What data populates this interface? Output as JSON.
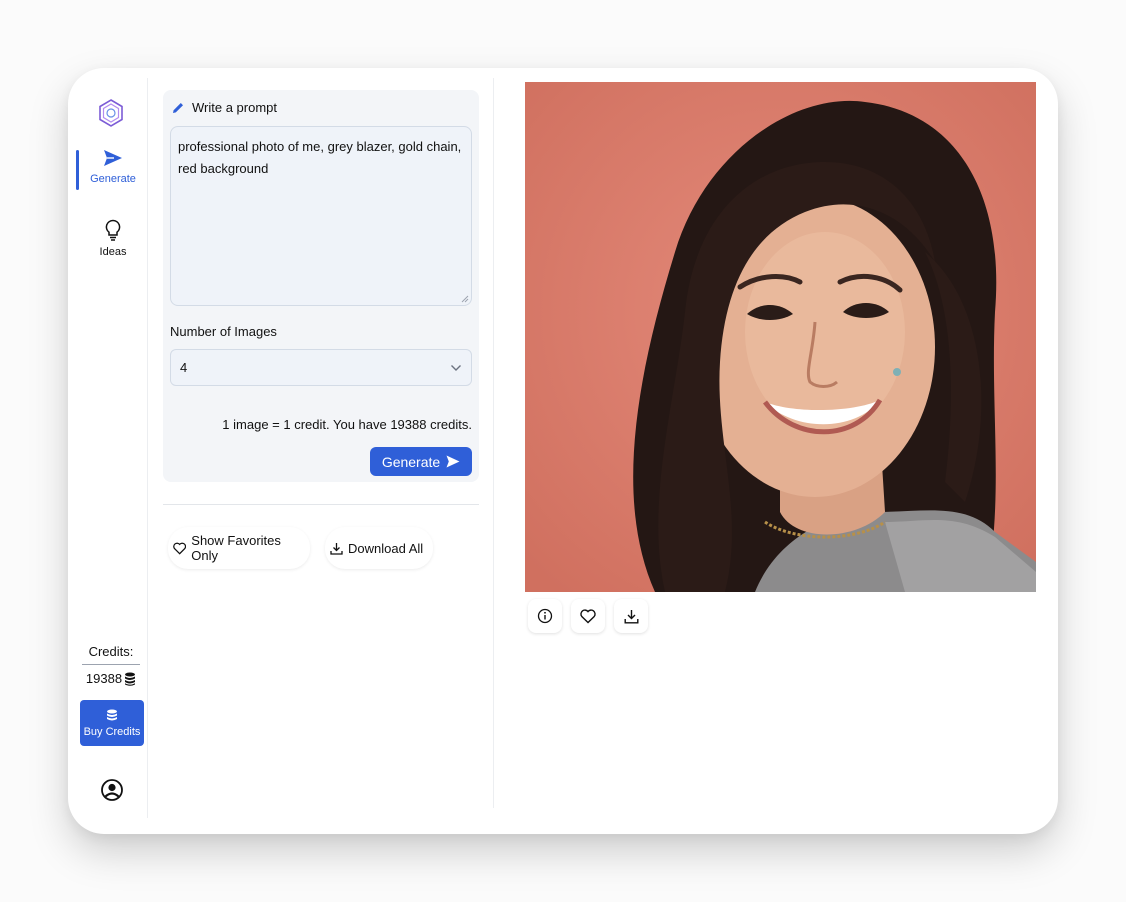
{
  "sidebar": {
    "nav": [
      {
        "label": "Generate",
        "icon": "send-icon"
      },
      {
        "label": "Ideas",
        "icon": "lightbulb-icon"
      }
    ],
    "credits_label": "Credits:",
    "credits_value": "19388",
    "buy_label": "Buy Credits"
  },
  "prompt_panel": {
    "title": "Write a prompt",
    "prompt_value": "professional photo of me, grey blazer, gold chain, red background",
    "num_images_label": "Number of Images",
    "num_images_value": "4",
    "credit_note": "1 image = 1 credit. You have 19388 credits.",
    "generate_label": "Generate"
  },
  "filters": {
    "favorites_label": "Show Favorites Only",
    "download_all_label": "Download All"
  },
  "colors": {
    "accent": "#2f5fd8",
    "panel_bg": "#f3f5f8",
    "photo_bg": "#d87a6c"
  }
}
